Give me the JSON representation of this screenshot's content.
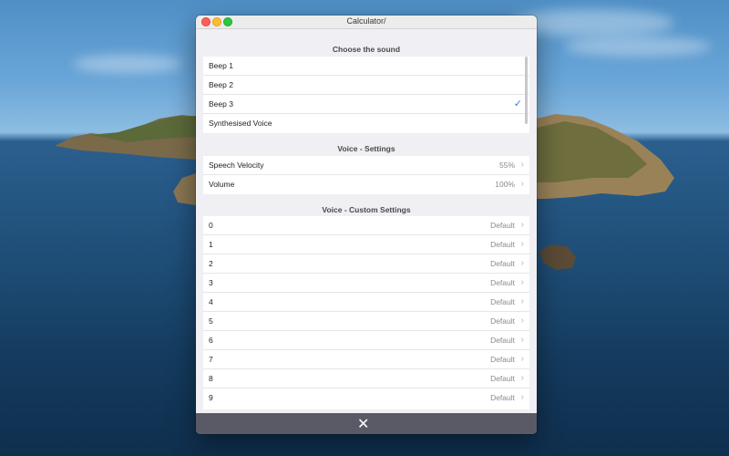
{
  "window": {
    "title": "Calculator/"
  },
  "sound_section": {
    "header": "Choose the sound",
    "items": [
      {
        "label": "Beep 1",
        "selected": false
      },
      {
        "label": "Beep 2",
        "selected": false
      },
      {
        "label": "Beep 3",
        "selected": true
      },
      {
        "label": "Synthesised Voice",
        "selected": false
      }
    ]
  },
  "voice_settings": {
    "header": "Voice - Settings",
    "items": [
      {
        "label": "Speech Velocity",
        "value": "55%"
      },
      {
        "label": "Volume",
        "value": "100%"
      }
    ]
  },
  "custom_settings": {
    "header": "Voice - Custom Settings",
    "items": [
      {
        "label": "0",
        "value": "Default"
      },
      {
        "label": "1",
        "value": "Default"
      },
      {
        "label": "2",
        "value": "Default"
      },
      {
        "label": "3",
        "value": "Default"
      },
      {
        "label": "4",
        "value": "Default"
      },
      {
        "label": "5",
        "value": "Default"
      },
      {
        "label": "6",
        "value": "Default"
      },
      {
        "label": "7",
        "value": "Default"
      },
      {
        "label": "8",
        "value": "Default"
      },
      {
        "label": "9",
        "value": "Default"
      }
    ]
  },
  "icons": {
    "check": "checkmark-icon",
    "chevron": "chevron-right-icon",
    "close": "close-icon"
  },
  "colors": {
    "accent": "#2d7fe0",
    "bottom_bar": "#5a5a66",
    "group_background": "#efeff4"
  }
}
